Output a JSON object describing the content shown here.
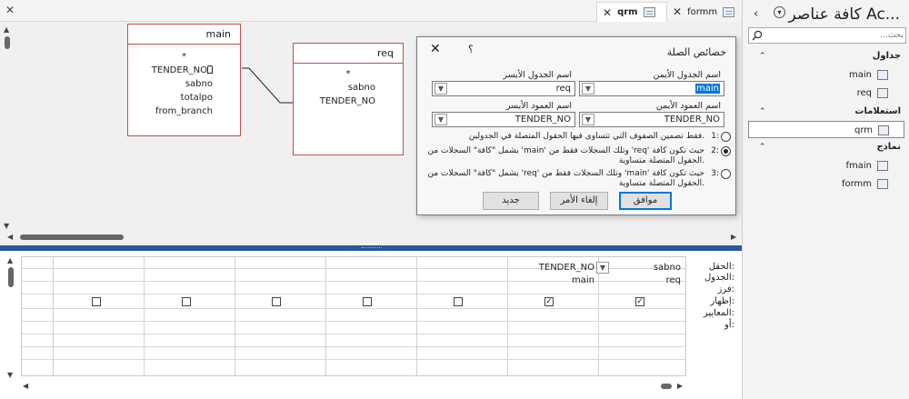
{
  "tabs": [
    {
      "label": "formm",
      "active": false
    },
    {
      "label": "qrm",
      "active": true
    }
  ],
  "tables": {
    "main": {
      "title": "main",
      "fields": [
        "*",
        "TENDER_NO",
        "sabno",
        "totalpo",
        "from_branch"
      ]
    },
    "req": {
      "title": "req",
      "fields": [
        "*",
        "sabno",
        "TENDER_NO"
      ]
    }
  },
  "dialog": {
    "title": "خصائص الصلة",
    "help": "؟",
    "left_table_label": "اسم الجدول الأيمن",
    "right_table_label": "اسم الجدول الأيسر",
    "left_table_value": "main",
    "right_table_value": "req",
    "left_column_label": "اسم العمود الأيمن",
    "right_column_label": "اسم العمود الأيسر",
    "left_column_value": "TENDER_NO",
    "right_column_value": "TENDER_NO",
    "options": [
      {
        "num": "1:",
        "text": "فقط تضمين الصفوف التي تتساوى فيها الحقول المتصلة في الجدولين.",
        "selected": false
      },
      {
        "num": "2:",
        "text": "يشمل \"كافة\" السجلات من 'main' وتلك السجلات فقط من 'req' حيث تكون كافة الحقول المتصلة متساوية.",
        "selected": true
      },
      {
        "num": "3:",
        "text": "يشمل \"كافة\" السجلات من 'req' وتلك السجلات فقط من 'main' حيث تكون كافة الحقول المتصلة متساوية.",
        "selected": false
      }
    ],
    "ok_label": "موافق",
    "cancel_label": "إلغاء الأمر",
    "new_label": "جديد"
  },
  "grid": {
    "row_labels": [
      "الحقل:",
      "الجدول:",
      "فرز:",
      "إظهار:",
      "المعايير:",
      "أو:"
    ],
    "columns": [
      {
        "field": "sabno",
        "table": "req",
        "show": true
      },
      {
        "field": "TENDER_NO",
        "table": "main",
        "show": true
      },
      {
        "field": "",
        "table": "",
        "show": false
      },
      {
        "field": "",
        "table": "",
        "show": false
      },
      {
        "field": "",
        "table": "",
        "show": false
      },
      {
        "field": "",
        "table": "",
        "show": false
      },
      {
        "field": "",
        "table": "",
        "show": false
      }
    ]
  },
  "nav": {
    "title": "كافة عناصر Ac...",
    "search_placeholder": "بحث...",
    "groups": [
      {
        "label": "جداول",
        "items": [
          {
            "label": "main",
            "icon": "table-icon"
          },
          {
            "label": "req",
            "icon": "table-icon"
          }
        ]
      },
      {
        "label": "استعلامات",
        "items": [
          {
            "label": "qrm",
            "icon": "query-icon",
            "selected": true
          }
        ]
      },
      {
        "label": "نماذج",
        "items": [
          {
            "label": "fmain",
            "icon": "form-icon"
          },
          {
            "label": "formm",
            "icon": "form-icon"
          }
        ]
      }
    ]
  }
}
